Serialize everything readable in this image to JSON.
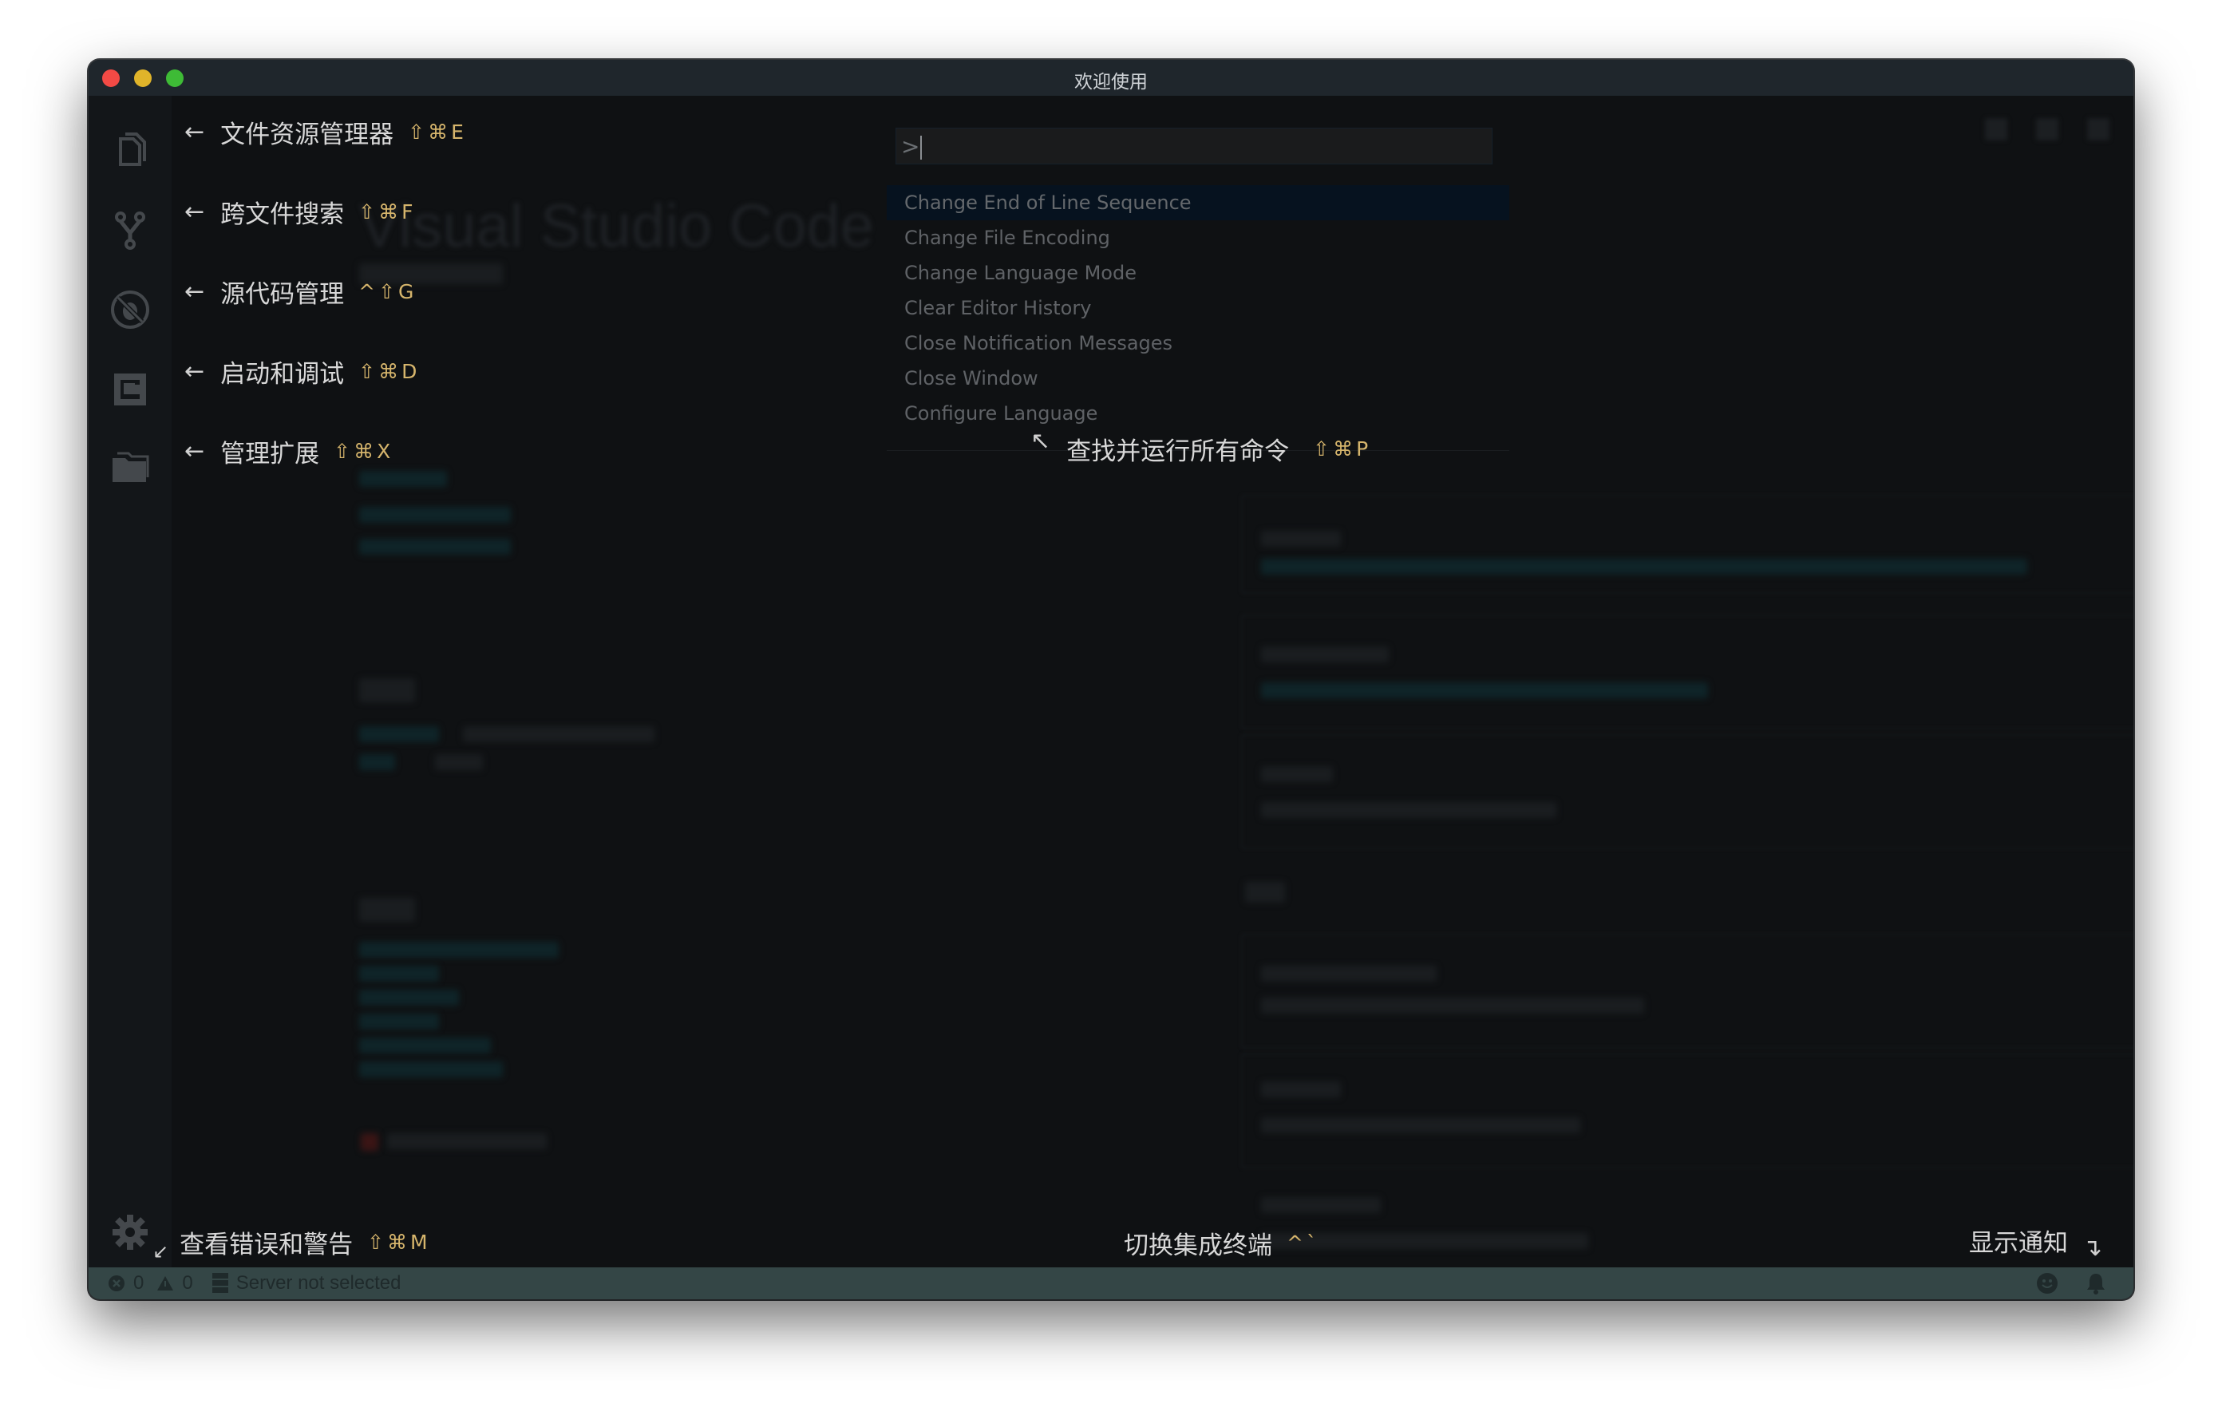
{
  "window": {
    "title": "欢迎使用"
  },
  "activity_bar": {
    "items": [
      {
        "name": "explorer",
        "icon": "files-icon"
      },
      {
        "name": "source-control",
        "icon": "git-branch-icon"
      },
      {
        "name": "debug",
        "icon": "no-bug-icon"
      },
      {
        "name": "extensions",
        "icon": "extensions-icon"
      },
      {
        "name": "folder",
        "icon": "folder-icon"
      }
    ],
    "settings_icon": "gear-icon"
  },
  "background": {
    "title": "Visual Studio Code"
  },
  "command_palette": {
    "input_value": ">",
    "items": [
      {
        "label": "Change End of Line Sequence",
        "selected": true
      },
      {
        "label": "Change File Encoding",
        "selected": false
      },
      {
        "label": "Change Language Mode",
        "selected": false
      },
      {
        "label": "Clear Editor History",
        "selected": false
      },
      {
        "label": "Close Notification Messages",
        "selected": false
      },
      {
        "label": "Close Window",
        "selected": false
      },
      {
        "label": "Configure Language",
        "selected": false
      }
    ]
  },
  "hints": {
    "explorer": {
      "arrow": "←",
      "label": "文件资源管理器",
      "keys": "⇧⌘E"
    },
    "search": {
      "arrow": "←",
      "label": "跨文件搜索",
      "keys": "⇧⌘F"
    },
    "scm": {
      "arrow": "←",
      "label": "源代码管理",
      "keys": "^⇧G"
    },
    "debug": {
      "arrow": "←",
      "label": "启动和调试",
      "keys": "⇧⌘D"
    },
    "extensions": {
      "arrow": "←",
      "label": "管理扩展",
      "keys": "⇧⌘X"
    },
    "commands": {
      "arrow": "↖",
      "label": "查找并运行所有命令",
      "keys": "⇧⌘P"
    },
    "problems": {
      "arrow": "↙",
      "label": "查看错误和警告",
      "keys": "⇧⌘M"
    },
    "terminal": {
      "label": "切换集成终端",
      "keys": "^`"
    },
    "notifications": {
      "label": "显示通知",
      "arrow": "↴"
    }
  },
  "status_bar": {
    "errors": "0",
    "warnings": "0",
    "server": "Server not selected"
  },
  "colors": {
    "shortcut_keys": "#d6b56c",
    "status_bar": "#344646",
    "title_bar": "#1f262c",
    "editor_bg": "#0f1113"
  }
}
